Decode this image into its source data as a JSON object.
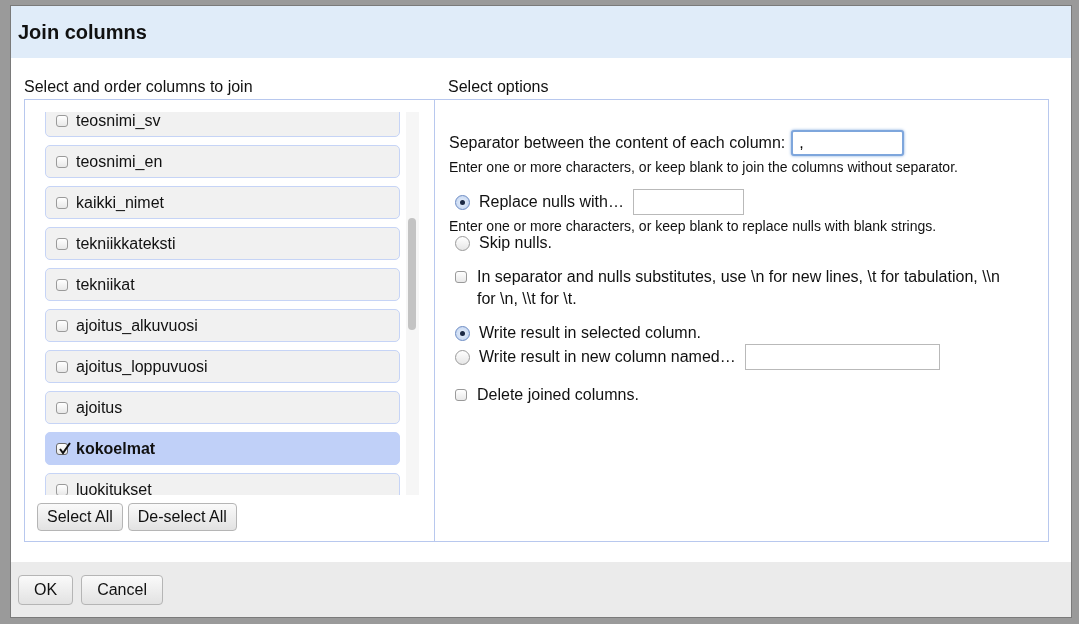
{
  "dialog": {
    "title": "Join columns"
  },
  "columns_panel": {
    "heading": "Select and order columns to join",
    "items": [
      {
        "label": "teosnimi_sv",
        "checked": false
      },
      {
        "label": "teosnimi_en",
        "checked": false
      },
      {
        "label": "kaikki_nimet",
        "checked": false
      },
      {
        "label": "tekniikkateksti",
        "checked": false
      },
      {
        "label": "tekniikat",
        "checked": false
      },
      {
        "label": "ajoitus_alkuvuosi",
        "checked": false
      },
      {
        "label": "ajoitus_loppuvuosi",
        "checked": false
      },
      {
        "label": "ajoitus",
        "checked": false
      },
      {
        "label": "kokoelmat",
        "checked": true
      },
      {
        "label": "luokitukset",
        "checked": false
      }
    ],
    "buttons": [
      "Select All",
      "De-select All"
    ]
  },
  "options_panel": {
    "heading": "Select options",
    "separator": {
      "label": "Separator between the content of each column:",
      "value": ",",
      "hint": "Enter one or more characters, or keep blank to join the columns without separator."
    },
    "null_handling": {
      "options": [
        {
          "label": "Replace nulls with…",
          "selected": true,
          "kind": "field",
          "hint": "Enter one or more characters, or keep blank to replace nulls with blank strings."
        },
        {
          "label": "Skip nulls.",
          "selected": false,
          "kind": "plain"
        }
      ]
    },
    "escape": {
      "label": "In separator and nulls substitutes, use \\n for new lines, \\t for tabulation, \\\\n for \\n, \\\\t for \\t.",
      "checked": false
    },
    "output": [
      {
        "label": "Write result in selected column.",
        "selected": true,
        "kind": "plain"
      },
      {
        "label": "Write result in new column named…",
        "selected": false,
        "kind": "field"
      }
    ],
    "delete_joined": {
      "label": "Delete joined columns.",
      "checked": false
    }
  },
  "footer_buttons": [
    "OK",
    "Cancel"
  ]
}
